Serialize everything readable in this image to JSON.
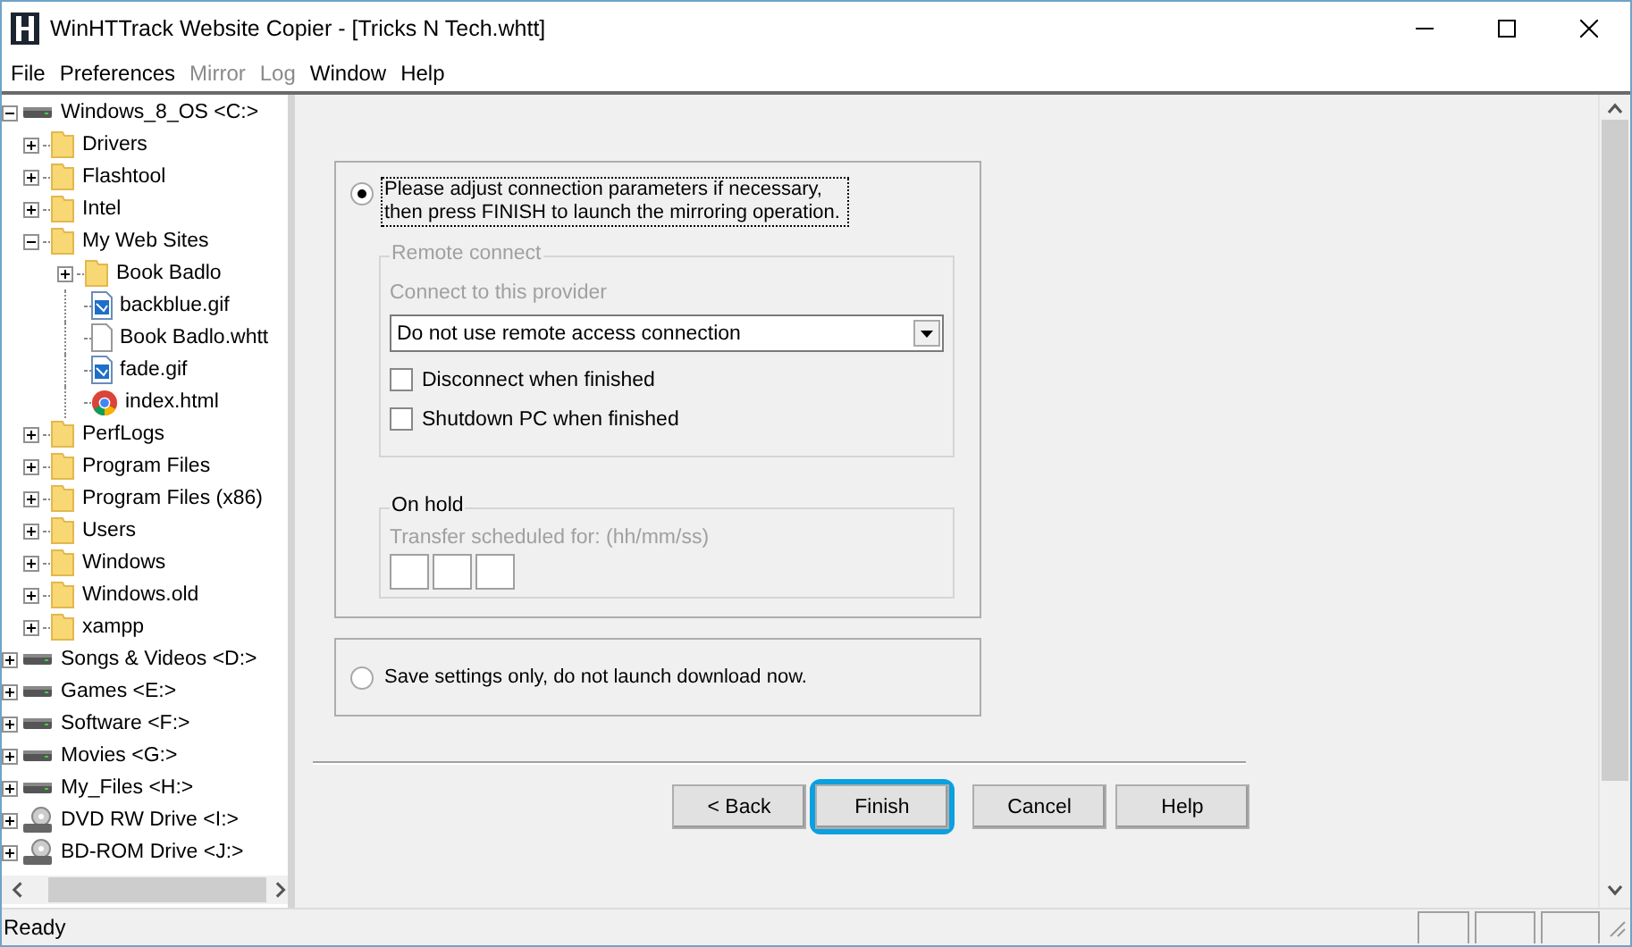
{
  "window": {
    "title": "WinHTTrack Website Copier - [Tricks N Tech.whtt]"
  },
  "menu": [
    {
      "label": "File",
      "disabled": false
    },
    {
      "label": "Preferences",
      "disabled": false
    },
    {
      "label": "Mirror",
      "disabled": true
    },
    {
      "label": "Log",
      "disabled": true
    },
    {
      "label": "Window",
      "disabled": false
    },
    {
      "label": "Help",
      "disabled": false
    }
  ],
  "tree": [
    {
      "label": "Windows_8_OS <C:>",
      "kind": "drive",
      "expanded": true,
      "children": [
        {
          "label": "Drivers",
          "kind": "folder",
          "expanded": false
        },
        {
          "label": "Flashtool",
          "kind": "folder",
          "expanded": false
        },
        {
          "label": "Intel",
          "kind": "folder",
          "expanded": false
        },
        {
          "label": "My Web Sites",
          "kind": "folder",
          "expanded": true,
          "children": [
            {
              "label": "Book Badlo",
              "kind": "folder",
              "expanded": false
            },
            {
              "label": "backblue.gif",
              "kind": "image"
            },
            {
              "label": "Book Badlo.whtt",
              "kind": "file"
            },
            {
              "label": "fade.gif",
              "kind": "image"
            },
            {
              "label": "index.html",
              "kind": "web"
            }
          ]
        },
        {
          "label": "PerfLogs",
          "kind": "folder",
          "expanded": false
        },
        {
          "label": "Program Files",
          "kind": "folder",
          "expanded": false
        },
        {
          "label": "Program Files (x86)",
          "kind": "folder",
          "expanded": false
        },
        {
          "label": "Users",
          "kind": "folder",
          "expanded": false
        },
        {
          "label": "Windows",
          "kind": "folder",
          "expanded": false
        },
        {
          "label": "Windows.old",
          "kind": "folder",
          "expanded": false
        },
        {
          "label": "xampp",
          "kind": "folder",
          "expanded": false
        }
      ]
    },
    {
      "label": "Songs & Videos <D:>",
      "kind": "drive",
      "expanded": false
    },
    {
      "label": "Games <E:>",
      "kind": "drive",
      "expanded": false
    },
    {
      "label": "Software <F:>",
      "kind": "drive",
      "expanded": false
    },
    {
      "label": "Movies <G:>",
      "kind": "drive",
      "expanded": false
    },
    {
      "label": "My_Files <H:>",
      "kind": "drive",
      "expanded": false
    },
    {
      "label": "DVD RW Drive <I:>",
      "kind": "optical",
      "expanded": false
    },
    {
      "label": "BD-ROM Drive <J:>",
      "kind": "optical",
      "expanded": false
    }
  ],
  "launch_option": {
    "label": "Please adjust connection parameters if necessary, then press FINISH to launch the mirroring operation.",
    "selected": true
  },
  "remote_connect": {
    "title": "Remote connect",
    "disabled": true,
    "provider_label": "Connect to this provider",
    "provider": "Do not use remote access connection",
    "checkboxes": [
      {
        "label": "Disconnect when finished",
        "checked": false
      },
      {
        "label": "Shutdown PC when finished",
        "checked": false
      }
    ]
  },
  "on_hold": {
    "title": "On hold",
    "hint": "Transfer scheduled for: (hh/mm/ss)",
    "disabled": true
  },
  "save_option": {
    "label": "Save settings only, do not launch download now.",
    "selected": false
  },
  "buttons": [
    {
      "label": "< Back",
      "highlighted": false
    },
    {
      "label": "Finish",
      "highlighted": true
    },
    {
      "label": "Cancel",
      "highlighted": false
    },
    {
      "label": "Help",
      "highlighted": false
    }
  ],
  "status_bar": {
    "text": "Ready"
  }
}
